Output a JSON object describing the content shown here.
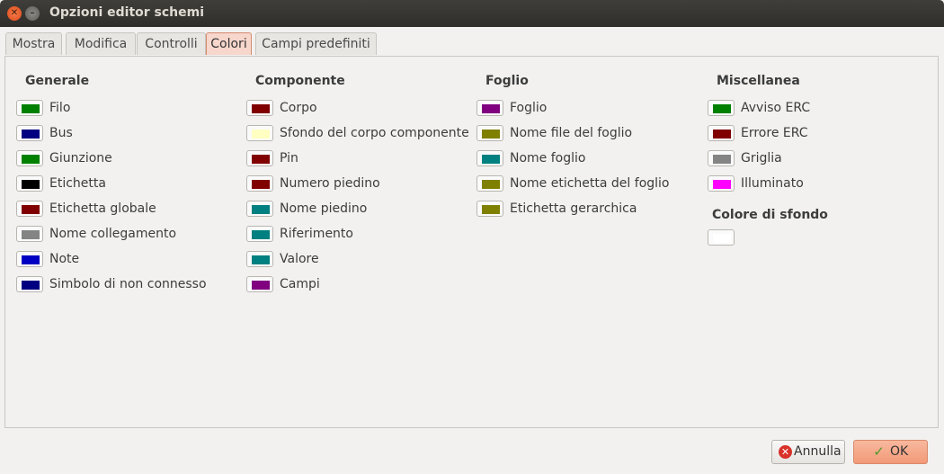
{
  "window": {
    "title": "Opzioni editor schemi"
  },
  "tabs": [
    "Mostra",
    "Modifica",
    "Controlli",
    "Colori",
    "Campi predefiniti"
  ],
  "sections": {
    "generale": {
      "title": "Generale",
      "items": [
        {
          "label": "Filo",
          "color": "#008000"
        },
        {
          "label": "Bus",
          "color": "#000080"
        },
        {
          "label": "Giunzione",
          "color": "#008000"
        },
        {
          "label": "Etichetta",
          "color": "#000000"
        },
        {
          "label": "Etichetta globale",
          "color": "#800000"
        },
        {
          "label": "Nome collegamento",
          "color": "#848484"
        },
        {
          "label": "Note",
          "color": "#0000c2"
        },
        {
          "label": "Simbolo di non connesso",
          "color": "#000080"
        }
      ]
    },
    "componente": {
      "title": "Componente",
      "items": [
        {
          "label": "Corpo",
          "color": "#800000"
        },
        {
          "label": "Sfondo del corpo componente",
          "color": "#ffffc2"
        },
        {
          "label": "Pin",
          "color": "#800000"
        },
        {
          "label": "Numero piedino",
          "color": "#800000"
        },
        {
          "label": "Nome piedino",
          "color": "#008080"
        },
        {
          "label": "Riferimento",
          "color": "#008080"
        },
        {
          "label": "Valore",
          "color": "#008080"
        },
        {
          "label": "Campi",
          "color": "#800080"
        }
      ]
    },
    "foglio": {
      "title": "Foglio",
      "items": [
        {
          "label": "Foglio",
          "color": "#800080"
        },
        {
          "label": "Nome file del foglio",
          "color": "#808000"
        },
        {
          "label": "Nome foglio",
          "color": "#008080"
        },
        {
          "label": "Nome etichetta del foglio",
          "color": "#808000"
        },
        {
          "label": "Etichetta gerarchica",
          "color": "#808000"
        }
      ]
    },
    "miscellanea": {
      "title": "Miscellanea",
      "items": [
        {
          "label": "Avviso ERC",
          "color": "#008000"
        },
        {
          "label": "Errore ERC",
          "color": "#800000"
        },
        {
          "label": "Griglia",
          "color": "#848484"
        },
        {
          "label": "Illuminato",
          "color": "#ff00ff"
        }
      ]
    },
    "sfondo": {
      "title": "Colore di sfondo",
      "color": "#ffffff"
    }
  },
  "buttons": {
    "cancel": "Annulla",
    "ok": "OK"
  }
}
